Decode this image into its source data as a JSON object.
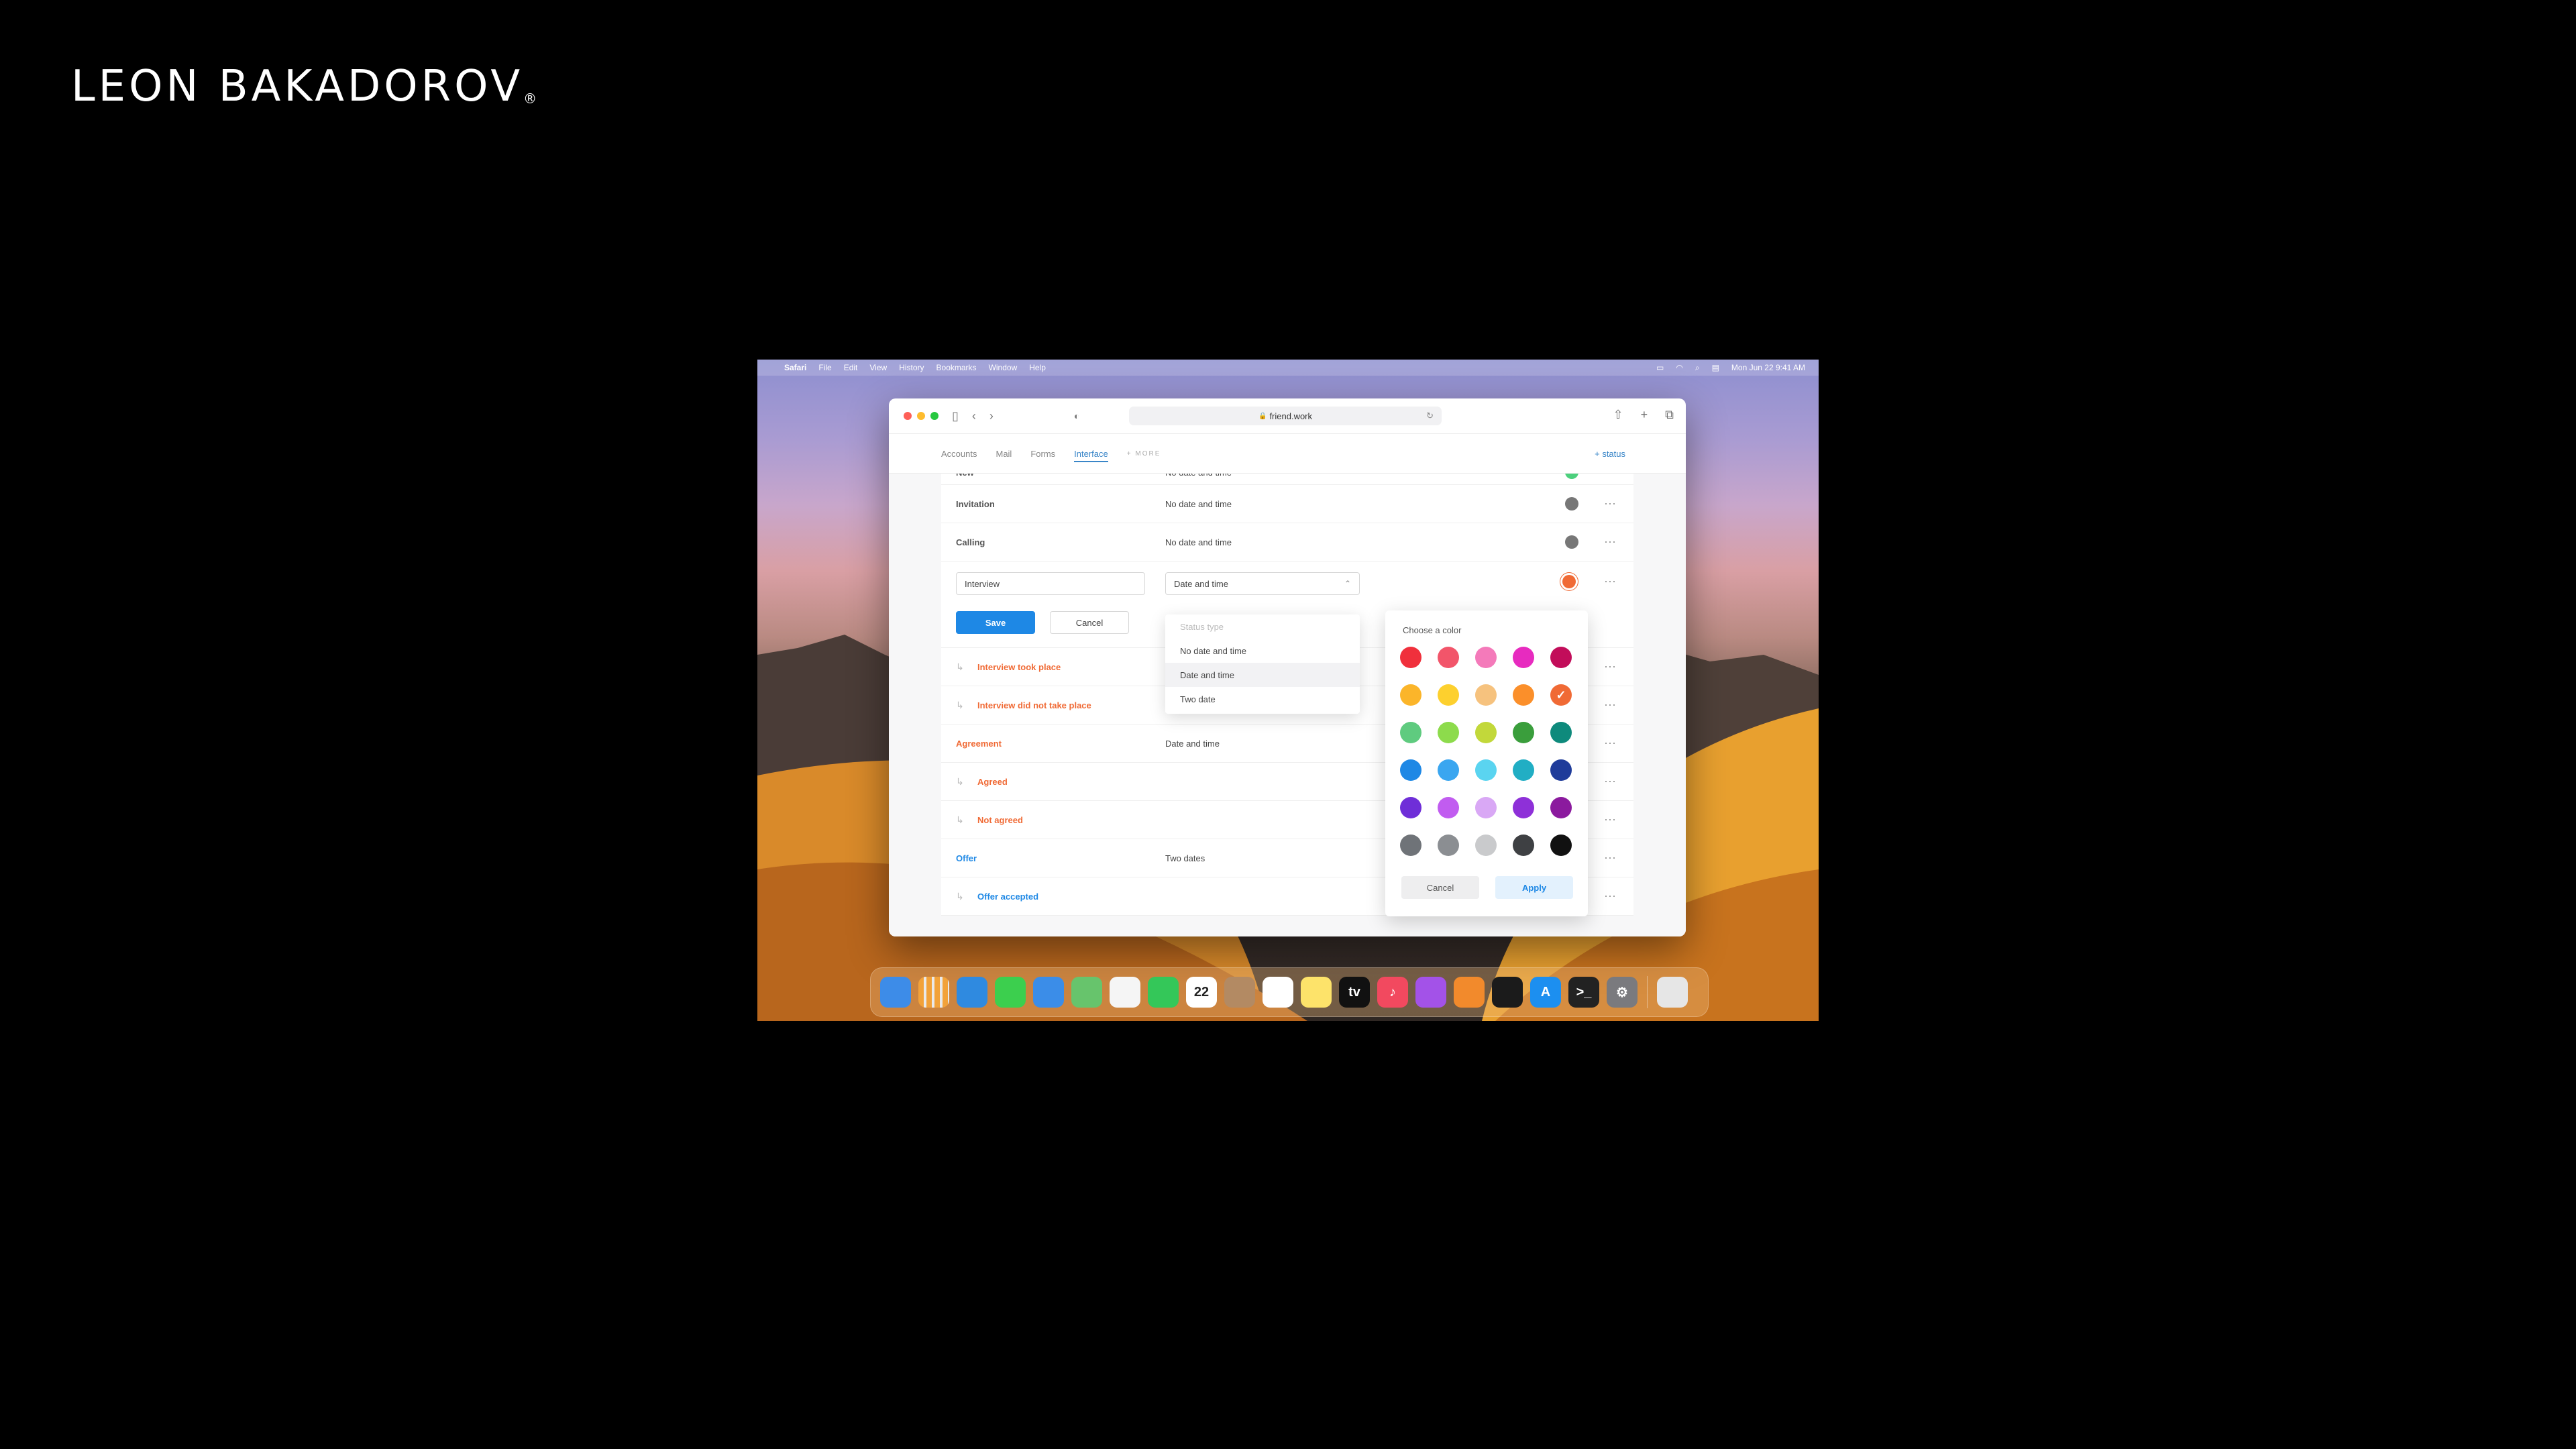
{
  "brand": {
    "text": "LEON BAKADOROV",
    "mark": "®"
  },
  "menubar": {
    "items": [
      "Safari",
      "File",
      "Edit",
      "View",
      "History",
      "Bookmarks",
      "Window",
      "Help"
    ],
    "clock": "Mon Jun 22  9:41 AM"
  },
  "browser": {
    "url": "friend.work"
  },
  "nav": {
    "tabs": [
      {
        "label": "Accounts",
        "active": false
      },
      {
        "label": "Mail",
        "active": false
      },
      {
        "label": "Forms",
        "active": false
      },
      {
        "label": "Interface",
        "active": true
      }
    ],
    "more": "+ MORE",
    "add_status": "+ status"
  },
  "statuses": {
    "partial_row": {
      "name": "New",
      "type": "No date and time",
      "color": "#4cd07d"
    },
    "rows_top": [
      {
        "name": "Invitation",
        "type": "No date and time",
        "color": "#777777"
      },
      {
        "name": "Calling",
        "type": "No date and time",
        "color": "#777777"
      }
    ],
    "edit": {
      "name_value": "Interview",
      "type_value": "Date and time",
      "save": "Save",
      "cancel": "Cancel",
      "color": "#f06a35"
    },
    "rows_bottom": [
      {
        "name": "Interview took place",
        "sub": true,
        "style": "orange",
        "type": ""
      },
      {
        "name": "Interview did not take place",
        "sub": true,
        "style": "orange",
        "type": ""
      },
      {
        "name": "Agreement",
        "sub": false,
        "style": "orange",
        "type": "Date and time"
      },
      {
        "name": "Agreed",
        "sub": true,
        "style": "orange",
        "type": ""
      },
      {
        "name": "Not agreed",
        "sub": true,
        "style": "orange",
        "type": ""
      },
      {
        "name": "Offer",
        "sub": false,
        "style": "blue",
        "type": "Two dates"
      },
      {
        "name": "Offer accepted",
        "sub": true,
        "style": "blue",
        "type": ""
      }
    ]
  },
  "dropdown": {
    "header": "Status type",
    "options": [
      "No date and time",
      "Date and time",
      "Two date"
    ],
    "selected": "Date and time"
  },
  "color_picker": {
    "title": "Choose a color",
    "colors": [
      [
        "#f0303c",
        "#f2556a",
        "#f47aba",
        "#e72bbf",
        "#c20d5a"
      ],
      [
        "#fbb52a",
        "#fdd02e",
        "#f6c27e",
        "#fb8f2a",
        "#f06a35"
      ],
      [
        "#5fcb7f",
        "#8ddb4c",
        "#c2d83a",
        "#3a9e3c",
        "#0e8a7c"
      ],
      [
        "#1e88e5",
        "#3aa6f0",
        "#5ad4f0",
        "#21aec4",
        "#1f3c9a"
      ],
      [
        "#6f2ed8",
        "#c15cf0",
        "#d9a8f5",
        "#8e30d8",
        "#8b1a9e"
      ],
      [
        "#6f7378",
        "#8b8e92",
        "#c9cacc",
        "#3e4043",
        "#111111"
      ]
    ],
    "selected": "#f06a35",
    "cancel": "Cancel",
    "apply": "Apply"
  },
  "dock": {
    "apps": [
      {
        "name": "finder",
        "color": "#3d8ce8",
        "glyph": ""
      },
      {
        "name": "launchpad",
        "color": "#e9e9ea",
        "glyph": ""
      },
      {
        "name": "safari",
        "color": "#2f8ae0",
        "glyph": ""
      },
      {
        "name": "messages",
        "color": "#3ccf4e",
        "glyph": ""
      },
      {
        "name": "mail",
        "color": "#3b8de8",
        "glyph": ""
      },
      {
        "name": "maps",
        "color": "#67c46c",
        "glyph": ""
      },
      {
        "name": "photos",
        "color": "#f5f5f5",
        "glyph": ""
      },
      {
        "name": "facetime",
        "color": "#34c759",
        "glyph": ""
      },
      {
        "name": "calendar",
        "color": "#ffffff",
        "glyph": "22"
      },
      {
        "name": "contacts",
        "color": "#b38a63",
        "glyph": ""
      },
      {
        "name": "reminders",
        "color": "#ffffff",
        "glyph": ""
      },
      {
        "name": "notes",
        "color": "#fde36a",
        "glyph": ""
      },
      {
        "name": "tv",
        "color": "#111111",
        "glyph": "tv"
      },
      {
        "name": "music",
        "color": "#f2495f",
        "glyph": "♪"
      },
      {
        "name": "podcasts",
        "color": "#a352e8",
        "glyph": ""
      },
      {
        "name": "books",
        "color": "#f28a2c",
        "glyph": ""
      },
      {
        "name": "voice-memos",
        "color": "#1b1b1b",
        "glyph": ""
      },
      {
        "name": "app-store",
        "color": "#1c8ff0",
        "glyph": "A"
      },
      {
        "name": "terminal",
        "color": "#222222",
        "glyph": ">_"
      },
      {
        "name": "system-preferences",
        "color": "#7a7a7e",
        "glyph": "⚙"
      }
    ],
    "trash": {
      "name": "trash",
      "color": "#e6e6e6"
    }
  }
}
